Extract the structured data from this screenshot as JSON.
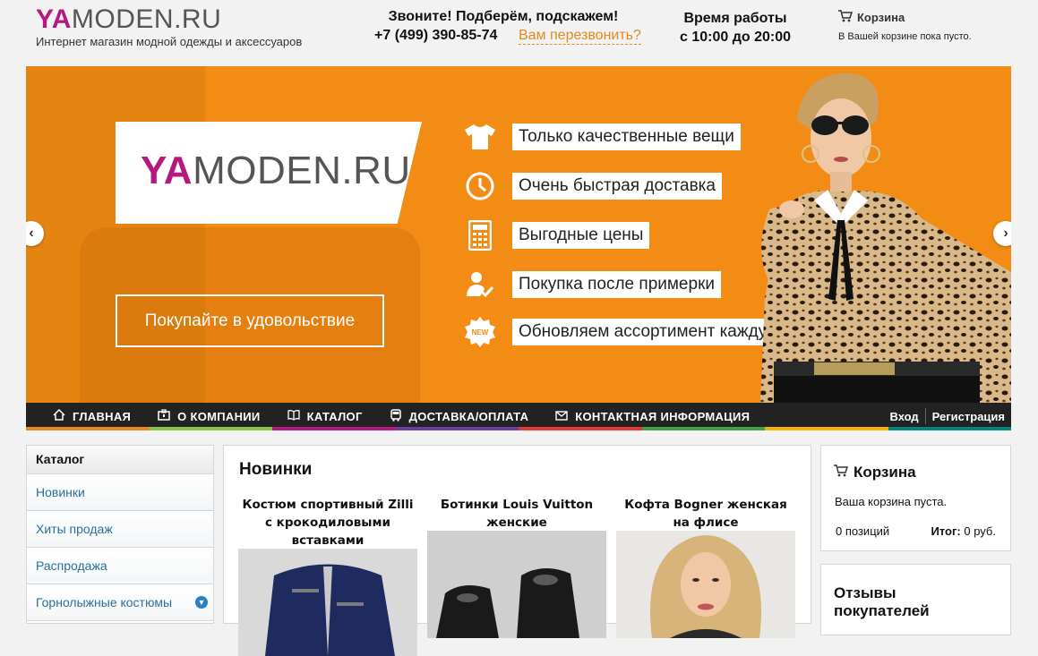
{
  "header": {
    "logo_ya": "YA",
    "logo_rest": "MODEN.RU",
    "tagline": "Интернет магазин модной одежды и аксессуаров",
    "call_title": "Звоните! Подберём, подскажем!",
    "phone": "+7 (499) 390-85-74",
    "callback_link": "Вам перезвонить?",
    "hours_title": "Время работы",
    "hours_value": "с 10:00 до 20:00",
    "cart_title": "Корзина",
    "cart_status": "В Вашей корзине пока пусто."
  },
  "banner": {
    "logo_ya": "YA",
    "logo_rest": "MODEN.RU",
    "cta": "Покупайте в удовольствие",
    "features": [
      {
        "icon": "tshirt-icon",
        "label": "Только качественные вещи"
      },
      {
        "icon": "clock-icon",
        "label": "Очень быстрая доставка"
      },
      {
        "icon": "calculator-icon",
        "label": "Выгодные цены"
      },
      {
        "icon": "user-check-icon",
        "label": "Покупка после примерки"
      },
      {
        "icon": "new-badge-icon",
        "label": "Обновляем ассортимент каждую неделю"
      }
    ],
    "new_badge_text": "NEW"
  },
  "nav": {
    "items": [
      {
        "icon": "home-icon",
        "label": "ГЛАВНАЯ"
      },
      {
        "icon": "company-icon",
        "label": "О КОМПАНИИ"
      },
      {
        "icon": "book-icon",
        "label": "КАТАЛОГ"
      },
      {
        "icon": "bus-icon",
        "label": "ДОСТАВКА/ОПЛАТА"
      },
      {
        "icon": "mail-icon",
        "label": "КОНТАКТНАЯ ИНФОРМАЦИЯ"
      }
    ],
    "login": "Вход",
    "register": "Регистрация",
    "stripe_colors": [
      "#e8891b",
      "#8bc34a",
      "#b5197f",
      "#6a3fa0",
      "#e53935",
      "#43a047",
      "#f4b400",
      "#00897b"
    ]
  },
  "sidebar": {
    "title": "Каталог",
    "items": [
      "Новинки",
      "Хиты продаж",
      "Распродажа",
      "Горнолыжные костюмы"
    ]
  },
  "new_products": {
    "title": "Новинки",
    "items": [
      {
        "name": "Костюм спортивный Zilli с крокодиловыми вставками"
      },
      {
        "name": "Ботинки Louis Vuitton женские"
      },
      {
        "name": "Кофта Bogner женская на флисе"
      }
    ]
  },
  "cart_widget": {
    "title": "Корзина",
    "empty": "Ваша корзина пуста.",
    "count": "0 позиций",
    "total_label": "Итог:",
    "total_value": "0 руб."
  },
  "reviews": {
    "title": "Отзывы покупателей"
  },
  "colors": {
    "accent": "#e8891b",
    "brand": "#b5197f",
    "banner": "#f28c14",
    "link": "#2a6f9b",
    "nav_bg": "#222222"
  }
}
